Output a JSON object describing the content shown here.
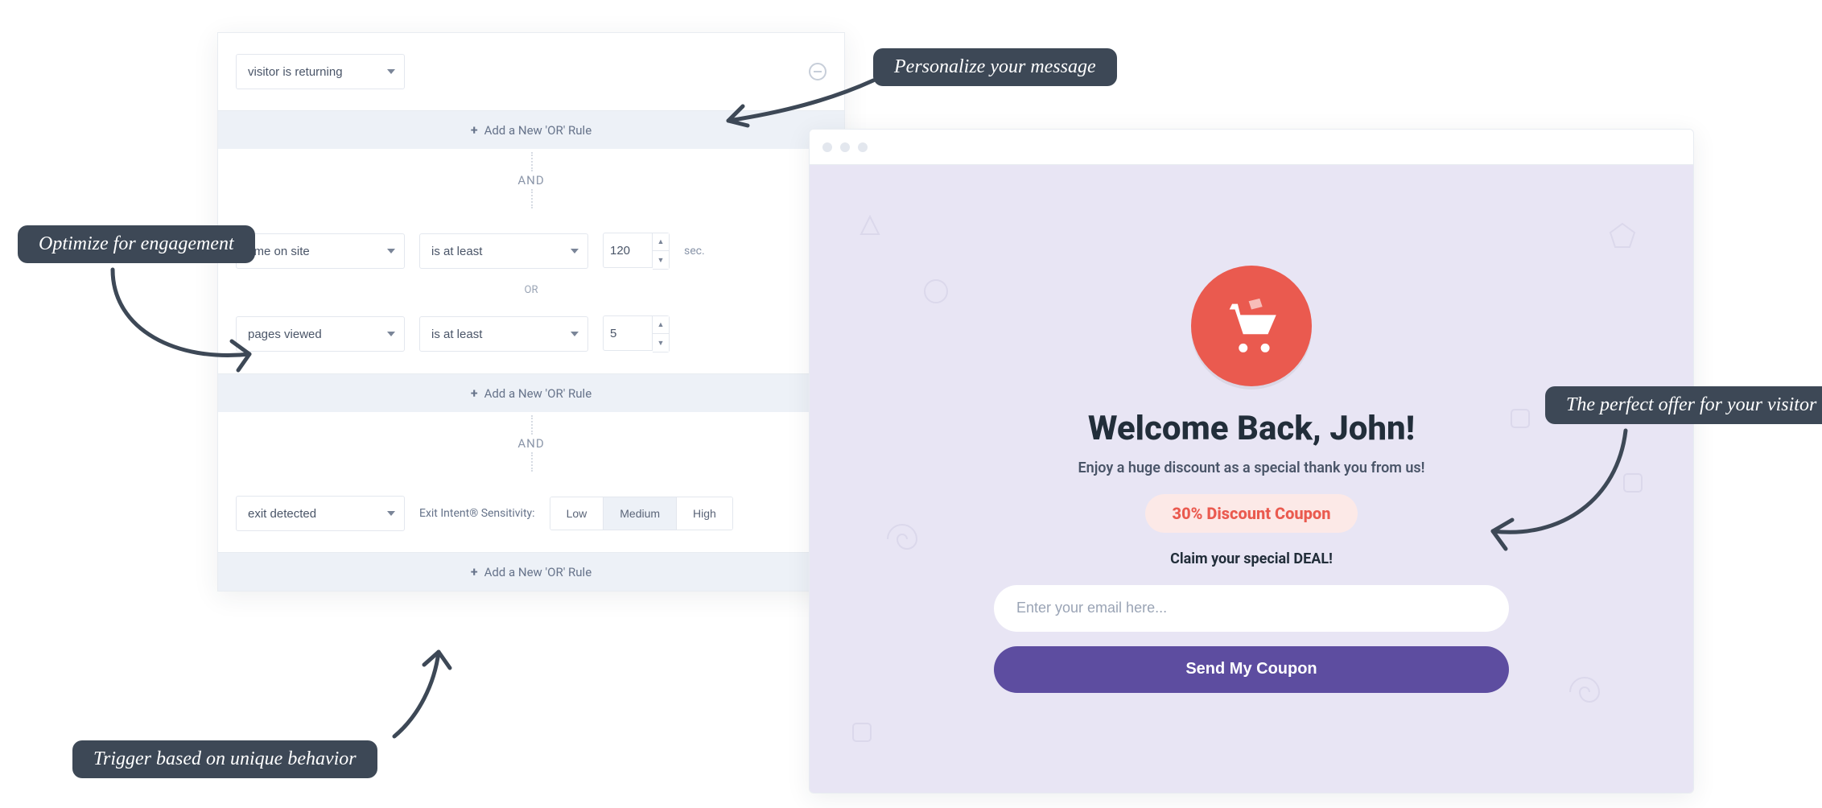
{
  "rules": {
    "group1": {
      "select1": "visitor is returning",
      "add_or": "Add a New 'OR' Rule"
    },
    "and": "AND",
    "or": "OR",
    "group2": {
      "row1": {
        "field": "time on site",
        "op": "is at least",
        "value": "120",
        "unit": "sec."
      },
      "row2": {
        "field": "pages viewed",
        "op": "is at least",
        "value": "5"
      },
      "add_or": "Add a New 'OR' Rule"
    },
    "group3": {
      "field": "exit detected",
      "sens_label": "Exit Intent® Sensitivity:",
      "opts": {
        "low": "Low",
        "med": "Medium",
        "high": "High"
      },
      "add_or": "Add a New 'OR' Rule"
    }
  },
  "popup": {
    "title": "Welcome Back, John!",
    "subtitle": "Enjoy a huge discount as a special thank you from us!",
    "coupon": "30% Discount Coupon",
    "claim": "Claim your special DEAL!",
    "email_placeholder": "Enter your email here...",
    "cta": "Send My Coupon"
  },
  "callouts": {
    "personalize": "Personalize your message",
    "optimize": "Optimize for engagement",
    "perfect_offer": "The perfect offer for your visitor",
    "trigger": "Trigger based on unique behavior"
  },
  "colors": {
    "accent_red": "#ea5a4f",
    "accent_purple": "#5d4da0",
    "callout_bg": "#3d4856"
  }
}
